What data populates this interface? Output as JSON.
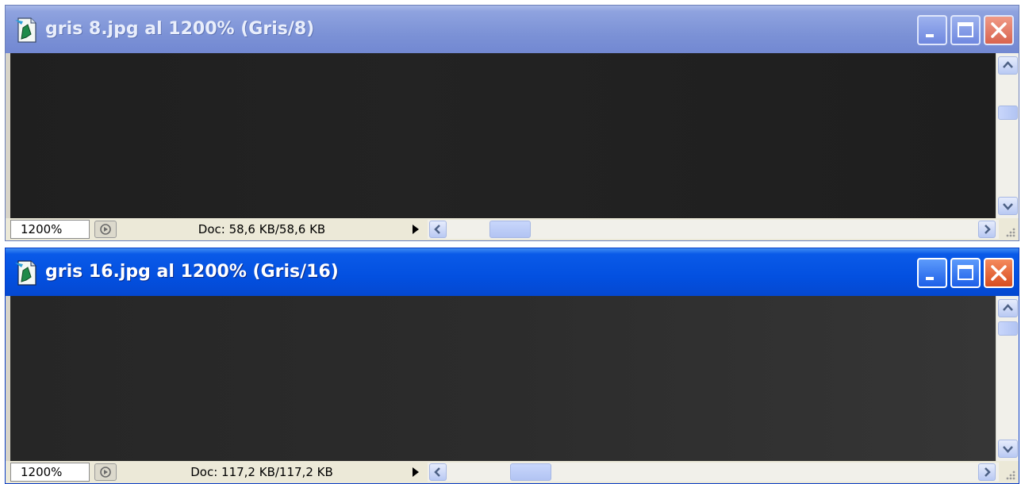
{
  "windows": [
    {
      "title": "gris 8.jpg al 1200% (Gris/8)",
      "zoom": "1200%",
      "doc_info": "Doc: 58,6 KB/58,6 KB",
      "active": false
    },
    {
      "title": "gris 16.jpg al 1200% (Gris/16)",
      "zoom": "1200%",
      "doc_info": "Doc: 117,2 KB/117,2 KB",
      "active": true
    }
  ],
  "icons": {
    "app": "photoshop-document-icon",
    "minimize": "minimize-icon",
    "maximize": "maximize-icon",
    "close": "close-icon",
    "preview": "preview-icon",
    "status_menu": "triangle-right-icon",
    "scroll_up": "chevron-up-icon",
    "scroll_down": "chevron-down-icon",
    "scroll_left": "chevron-left-icon",
    "scroll_right": "chevron-right-icon",
    "resize": "resize-grip-icon"
  },
  "colors": {
    "inactive_titlebar": "#7c92d6",
    "active_titlebar": "#0350e0",
    "close_button": "#d84d20",
    "canvas_8bit": "#212121",
    "canvas_16bit": "#2e2e2e"
  }
}
